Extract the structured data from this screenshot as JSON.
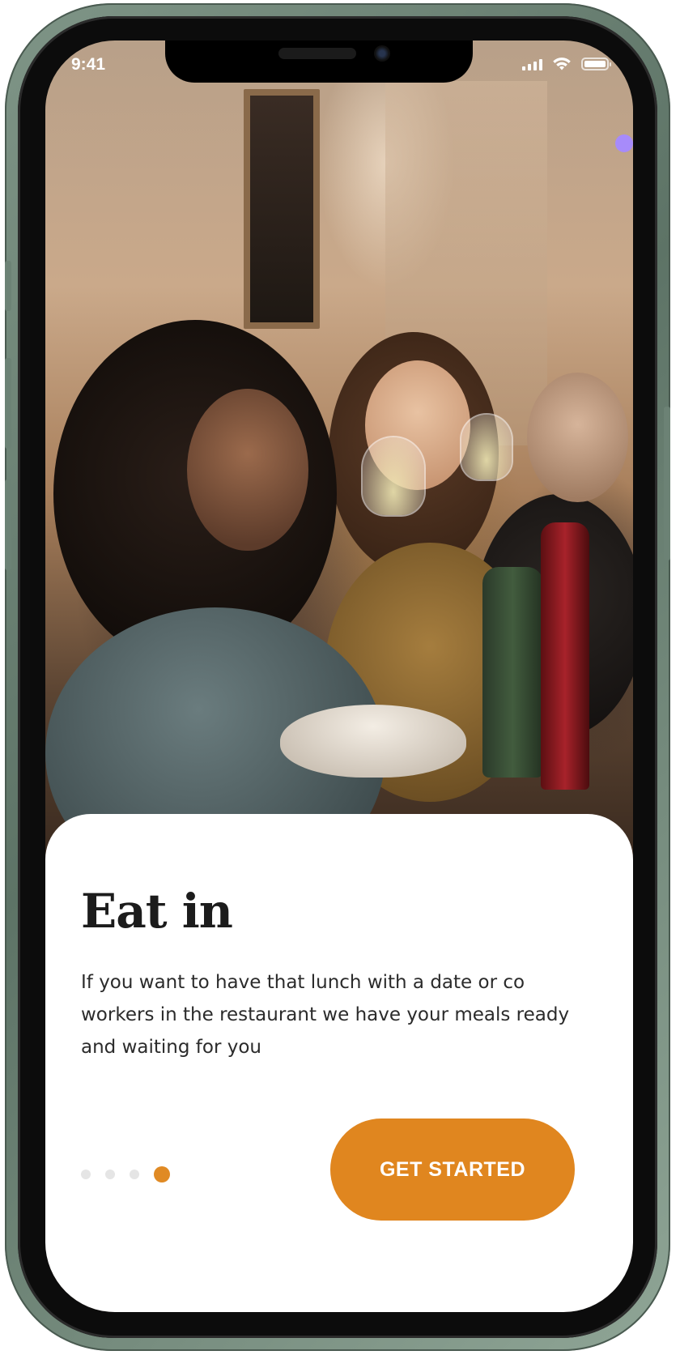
{
  "status_bar": {
    "time": "9:41",
    "signal_icon": "signal-bars-icon",
    "wifi_icon": "wifi-icon",
    "battery_icon": "battery-icon"
  },
  "hero": {
    "image": "people-toasting-wine-at-dinner-table-photo"
  },
  "card": {
    "title": "Eat in",
    "description": "If you want to have that lunch with a date or co workers in the restaurant we have your meals ready and waiting for you"
  },
  "pagination": {
    "total": 4,
    "active_index": 3
  },
  "cta": {
    "label": "GET STARTED"
  },
  "colors": {
    "accent": "#E0861F",
    "inactive_dot": "#E5E5E5",
    "title_text": "#1C1C1C",
    "body_text": "#2B2B2B",
    "phone_frame": "#6C8275"
  }
}
